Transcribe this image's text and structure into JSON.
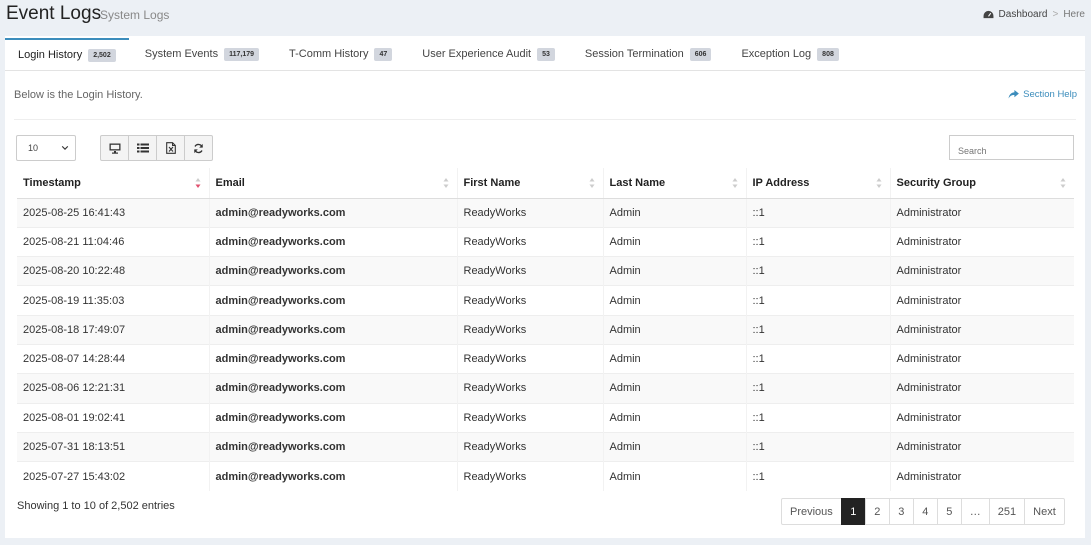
{
  "header": {
    "title": "Event Logs",
    "subtitle": "System Logs"
  },
  "breadcrumb": {
    "dashboard": "Dashboard",
    "separator": ">",
    "current": "Here"
  },
  "tabs": [
    {
      "label": "Login History",
      "badge": "2,502",
      "active": true
    },
    {
      "label": "System Events",
      "badge": "117,179",
      "active": false
    },
    {
      "label": "T-Comm History",
      "badge": "47",
      "active": false
    },
    {
      "label": "User Experience Audit",
      "badge": "53",
      "active": false
    },
    {
      "label": "Session Termination",
      "badge": "606",
      "active": false
    },
    {
      "label": "Exception Log",
      "badge": "808",
      "active": false
    }
  ],
  "intro": "Below is the Login History.",
  "section_help": "Section Help",
  "controls": {
    "page_size": "10",
    "search_placeholder": "Search"
  },
  "table": {
    "columns": [
      "Timestamp",
      "Email",
      "First Name",
      "Last Name",
      "IP Address",
      "Security Group"
    ],
    "rows": [
      [
        "2025-08-25 16:41:43",
        "admin@readyworks.com",
        "ReadyWorks",
        "Admin",
        "::1",
        "Administrator"
      ],
      [
        "2025-08-21 11:04:46",
        "admin@readyworks.com",
        "ReadyWorks",
        "Admin",
        "::1",
        "Administrator"
      ],
      [
        "2025-08-20 10:22:48",
        "admin@readyworks.com",
        "ReadyWorks",
        "Admin",
        "::1",
        "Administrator"
      ],
      [
        "2025-08-19 11:35:03",
        "admin@readyworks.com",
        "ReadyWorks",
        "Admin",
        "::1",
        "Administrator"
      ],
      [
        "2025-08-18 17:49:07",
        "admin@readyworks.com",
        "ReadyWorks",
        "Admin",
        "::1",
        "Administrator"
      ],
      [
        "2025-08-07 14:28:44",
        "admin@readyworks.com",
        "ReadyWorks",
        "Admin",
        "::1",
        "Administrator"
      ],
      [
        "2025-08-06 12:21:31",
        "admin@readyworks.com",
        "ReadyWorks",
        "Admin",
        "::1",
        "Administrator"
      ],
      [
        "2025-08-01 19:02:41",
        "admin@readyworks.com",
        "ReadyWorks",
        "Admin",
        "::1",
        "Administrator"
      ],
      [
        "2025-07-31 18:13:51",
        "admin@readyworks.com",
        "ReadyWorks",
        "Admin",
        "::1",
        "Administrator"
      ],
      [
        "2025-07-27 15:43:02",
        "admin@readyworks.com",
        "ReadyWorks",
        "Admin",
        "::1",
        "Administrator"
      ]
    ]
  },
  "footer": {
    "info": "Showing 1 to 10 of 2,502 entries",
    "pagination": [
      "Previous",
      "1",
      "2",
      "3",
      "4",
      "5",
      "…",
      "251",
      "Next"
    ],
    "active_page": "1"
  },
  "colors": {
    "accent": "#3c8dbc",
    "active_page": "#222222",
    "sort_active": "#e0506e"
  },
  "icons": [
    "dashboard-icon",
    "share-icon",
    "desktop-icon",
    "list-icon",
    "file-export-icon",
    "refresh-icon",
    "chevron-down-icon",
    "sort-icon"
  ]
}
